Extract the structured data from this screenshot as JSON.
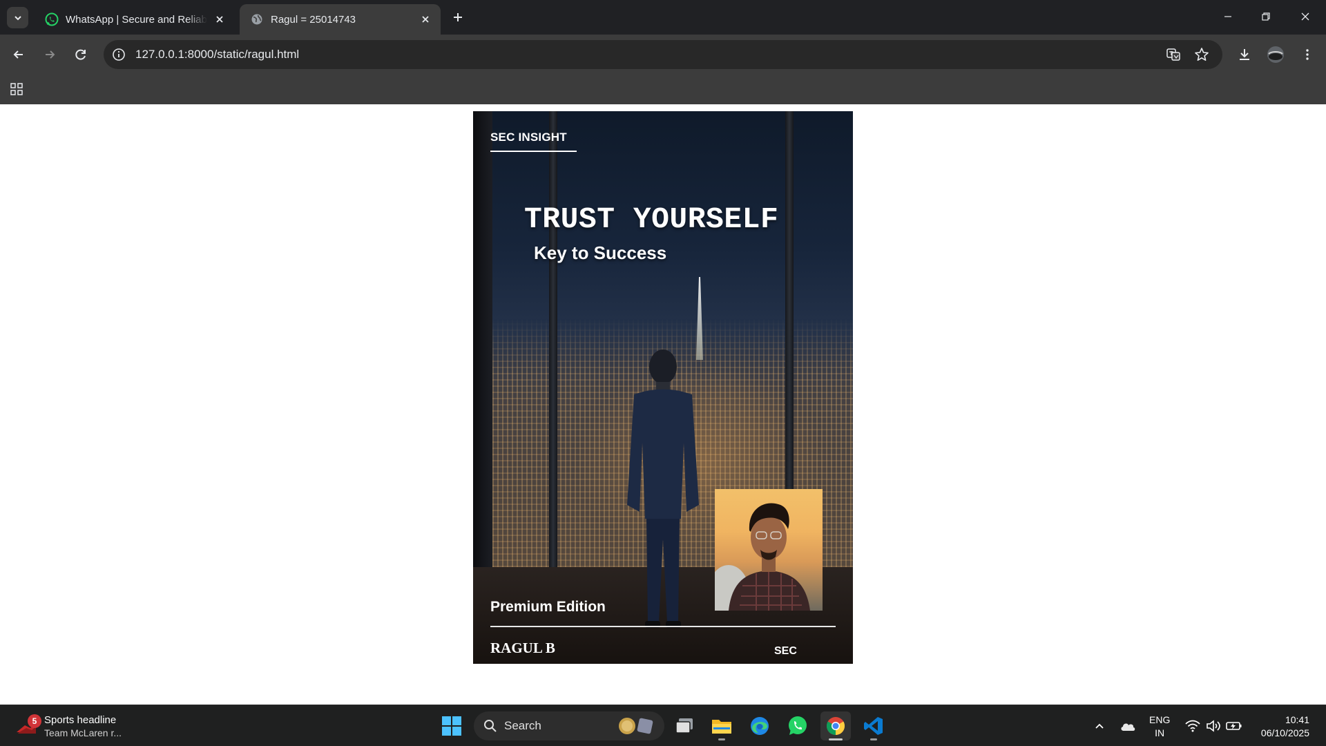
{
  "browser": {
    "tabs": [
      {
        "title": "WhatsApp | Secure and Reliable Free Private Messaging and Calling",
        "icon": "whatsapp-icon",
        "active": false
      },
      {
        "title": "Ragul = 25014743",
        "icon": "globe-icon",
        "active": true
      }
    ],
    "url": "127.0.0.1:8000/static/ragul.html"
  },
  "cover": {
    "brand": "SEC INSIGHT",
    "headline": "TRUST YOURSELF",
    "subheadline": "Key to Success",
    "edition": "Premium Edition",
    "author": "RAGUL B",
    "publisher": "SEC"
  },
  "taskbar": {
    "widget": {
      "badge": "5",
      "title": "Sports headline",
      "subtitle": "Team McLaren r..."
    },
    "search_label": "Search",
    "language": {
      "line1": "ENG",
      "line2": "IN"
    },
    "clock": {
      "time": "10:41",
      "date": "06/10/2025"
    }
  },
  "colors": {
    "chrome_dark": "#202124",
    "chrome_toolbar": "#3c3c3c",
    "whatsapp_green": "#25d366",
    "taskbar": "#1f2020"
  }
}
